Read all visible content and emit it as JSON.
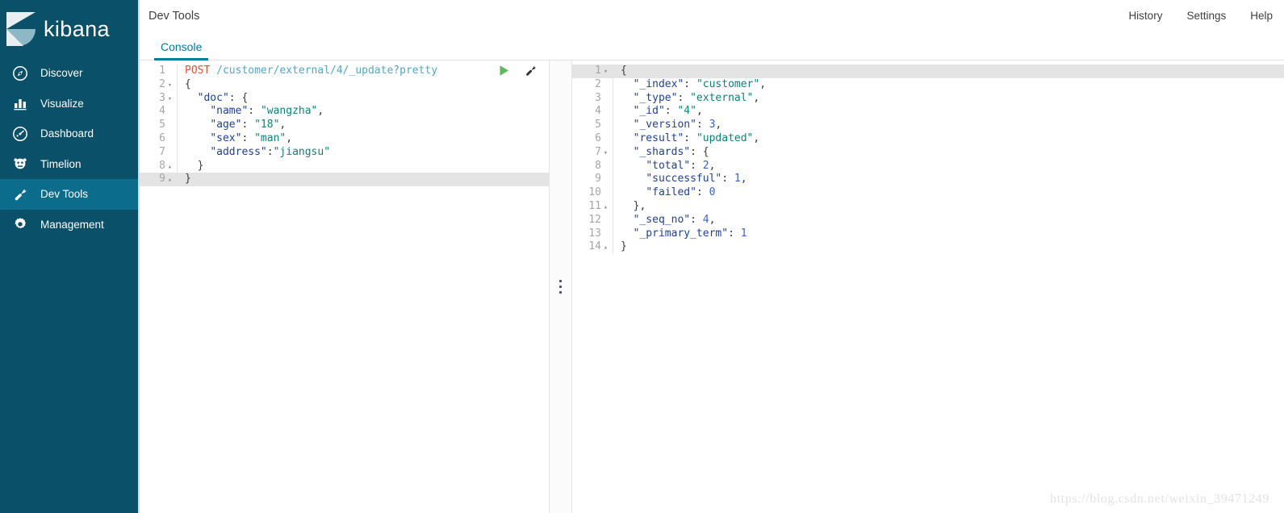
{
  "brand": {
    "name": "kibana",
    "logo_icon": "kibana-k-logo"
  },
  "sidebar": {
    "items": [
      {
        "label": "Discover",
        "icon": "compass-icon",
        "active": false
      },
      {
        "label": "Visualize",
        "icon": "bar-chart-icon",
        "active": false
      },
      {
        "label": "Dashboard",
        "icon": "dashboard-icon",
        "active": false
      },
      {
        "label": "Timelion",
        "icon": "timelion-icon",
        "active": false
      },
      {
        "label": "Dev Tools",
        "icon": "wrench-icon",
        "active": true
      },
      {
        "label": "Management",
        "icon": "gear-icon",
        "active": false
      }
    ]
  },
  "header": {
    "title": "Dev Tools",
    "links": [
      {
        "label": "History"
      },
      {
        "label": "Settings"
      },
      {
        "label": "Help"
      }
    ]
  },
  "tabs": [
    {
      "label": "Console",
      "active": true
    }
  ],
  "console": {
    "actions": [
      {
        "name": "send-request-button",
        "icon": "play-icon",
        "color": "#5bb85b"
      },
      {
        "name": "wrench-menu-button",
        "icon": "wrench-icon",
        "color": "#333333"
      }
    ],
    "request": {
      "highlighted_line": 9,
      "lines": [
        {
          "n": 1,
          "fold": "",
          "tokens": [
            {
              "t": "POST",
              "c": "tok-method"
            },
            {
              "t": " ",
              "c": "tok-punc"
            },
            {
              "t": "/customer/external/4/_update?pretty",
              "c": "tok-url"
            }
          ]
        },
        {
          "n": 2,
          "fold": "▾",
          "tokens": [
            {
              "t": "{",
              "c": "tok-punc"
            }
          ]
        },
        {
          "n": 3,
          "fold": "▾",
          "tokens": [
            {
              "t": "  ",
              "c": "tok-punc"
            },
            {
              "t": "\"doc\"",
              "c": "tok-key"
            },
            {
              "t": ": {",
              "c": "tok-punc"
            }
          ]
        },
        {
          "n": 4,
          "fold": "",
          "tokens": [
            {
              "t": "    ",
              "c": "tok-punc"
            },
            {
              "t": "\"name\"",
              "c": "tok-key"
            },
            {
              "t": ": ",
              "c": "tok-punc"
            },
            {
              "t": "\"wangzha\"",
              "c": "tok-str"
            },
            {
              "t": ",",
              "c": "tok-punc"
            }
          ]
        },
        {
          "n": 5,
          "fold": "",
          "tokens": [
            {
              "t": "    ",
              "c": "tok-punc"
            },
            {
              "t": "\"age\"",
              "c": "tok-key"
            },
            {
              "t": ": ",
              "c": "tok-punc"
            },
            {
              "t": "\"18\"",
              "c": "tok-str"
            },
            {
              "t": ",",
              "c": "tok-punc"
            }
          ]
        },
        {
          "n": 6,
          "fold": "",
          "tokens": [
            {
              "t": "    ",
              "c": "tok-punc"
            },
            {
              "t": "\"sex\"",
              "c": "tok-key"
            },
            {
              "t": ": ",
              "c": "tok-punc"
            },
            {
              "t": "\"man\"",
              "c": "tok-str"
            },
            {
              "t": ",",
              "c": "tok-punc"
            }
          ]
        },
        {
          "n": 7,
          "fold": "",
          "tokens": [
            {
              "t": "    ",
              "c": "tok-punc"
            },
            {
              "t": "\"address\"",
              "c": "tok-key"
            },
            {
              "t": ":",
              "c": "tok-punc"
            },
            {
              "t": "\"jiangsu\"",
              "c": "tok-str"
            }
          ]
        },
        {
          "n": 8,
          "fold": "▴",
          "tokens": [
            {
              "t": "  }",
              "c": "tok-punc"
            }
          ]
        },
        {
          "n": 9,
          "fold": "▴",
          "tokens": [
            {
              "t": "}",
              "c": "tok-punc"
            }
          ]
        }
      ]
    },
    "response": {
      "highlighted_line": 1,
      "lines": [
        {
          "n": 1,
          "fold": "▾",
          "tokens": [
            {
              "t": "{",
              "c": "tok-punc"
            }
          ]
        },
        {
          "n": 2,
          "fold": "",
          "tokens": [
            {
              "t": "  ",
              "c": "tok-punc"
            },
            {
              "t": "\"_index\"",
              "c": "tok-key"
            },
            {
              "t": ": ",
              "c": "tok-punc"
            },
            {
              "t": "\"customer\"",
              "c": "tok-str"
            },
            {
              "t": ",",
              "c": "tok-punc"
            }
          ]
        },
        {
          "n": 3,
          "fold": "",
          "tokens": [
            {
              "t": "  ",
              "c": "tok-punc"
            },
            {
              "t": "\"_type\"",
              "c": "tok-key"
            },
            {
              "t": ": ",
              "c": "tok-punc"
            },
            {
              "t": "\"external\"",
              "c": "tok-str"
            },
            {
              "t": ",",
              "c": "tok-punc"
            }
          ]
        },
        {
          "n": 4,
          "fold": "",
          "tokens": [
            {
              "t": "  ",
              "c": "tok-punc"
            },
            {
              "t": "\"_id\"",
              "c": "tok-key"
            },
            {
              "t": ": ",
              "c": "tok-punc"
            },
            {
              "t": "\"4\"",
              "c": "tok-str"
            },
            {
              "t": ",",
              "c": "tok-punc"
            }
          ]
        },
        {
          "n": 5,
          "fold": "",
          "tokens": [
            {
              "t": "  ",
              "c": "tok-punc"
            },
            {
              "t": "\"_version\"",
              "c": "tok-key"
            },
            {
              "t": ": ",
              "c": "tok-punc"
            },
            {
              "t": "3",
              "c": "tok-num"
            },
            {
              "t": ",",
              "c": "tok-punc"
            }
          ]
        },
        {
          "n": 6,
          "fold": "",
          "tokens": [
            {
              "t": "  ",
              "c": "tok-punc"
            },
            {
              "t": "\"result\"",
              "c": "tok-key"
            },
            {
              "t": ": ",
              "c": "tok-punc"
            },
            {
              "t": "\"updated\"",
              "c": "tok-str"
            },
            {
              "t": ",",
              "c": "tok-punc"
            }
          ]
        },
        {
          "n": 7,
          "fold": "▾",
          "tokens": [
            {
              "t": "  ",
              "c": "tok-punc"
            },
            {
              "t": "\"_shards\"",
              "c": "tok-key"
            },
            {
              "t": ": {",
              "c": "tok-punc"
            }
          ]
        },
        {
          "n": 8,
          "fold": "",
          "tokens": [
            {
              "t": "    ",
              "c": "tok-punc"
            },
            {
              "t": "\"total\"",
              "c": "tok-key"
            },
            {
              "t": ": ",
              "c": "tok-punc"
            },
            {
              "t": "2",
              "c": "tok-num"
            },
            {
              "t": ",",
              "c": "tok-punc"
            }
          ]
        },
        {
          "n": 9,
          "fold": "",
          "tokens": [
            {
              "t": "    ",
              "c": "tok-punc"
            },
            {
              "t": "\"successful\"",
              "c": "tok-key"
            },
            {
              "t": ": ",
              "c": "tok-punc"
            },
            {
              "t": "1",
              "c": "tok-num"
            },
            {
              "t": ",",
              "c": "tok-punc"
            }
          ]
        },
        {
          "n": 10,
          "fold": "",
          "tokens": [
            {
              "t": "    ",
              "c": "tok-punc"
            },
            {
              "t": "\"failed\"",
              "c": "tok-key"
            },
            {
              "t": ": ",
              "c": "tok-punc"
            },
            {
              "t": "0",
              "c": "tok-num"
            }
          ]
        },
        {
          "n": 11,
          "fold": "▴",
          "tokens": [
            {
              "t": "  },",
              "c": "tok-punc"
            }
          ]
        },
        {
          "n": 12,
          "fold": "",
          "tokens": [
            {
              "t": "  ",
              "c": "tok-punc"
            },
            {
              "t": "\"_seq_no\"",
              "c": "tok-key"
            },
            {
              "t": ": ",
              "c": "tok-punc"
            },
            {
              "t": "4",
              "c": "tok-num"
            },
            {
              "t": ",",
              "c": "tok-punc"
            }
          ]
        },
        {
          "n": 13,
          "fold": "",
          "tokens": [
            {
              "t": "  ",
              "c": "tok-punc"
            },
            {
              "t": "\"_primary_term\"",
              "c": "tok-key"
            },
            {
              "t": ": ",
              "c": "tok-punc"
            },
            {
              "t": "1",
              "c": "tok-num"
            }
          ]
        },
        {
          "n": 14,
          "fold": "▴",
          "tokens": [
            {
              "t": "}",
              "c": "tok-punc"
            }
          ]
        }
      ]
    },
    "splitter_icon": "drag-handle-dots"
  },
  "watermark": {
    "text": "https://blog.csdn.net/weixin_39471249"
  },
  "colors": {
    "sidebar_bg": "#0a5069",
    "sidebar_active": "#0b6c8c",
    "tab_accent": "#017d9e",
    "link": "#0079a5",
    "play": "#5bb85b"
  }
}
